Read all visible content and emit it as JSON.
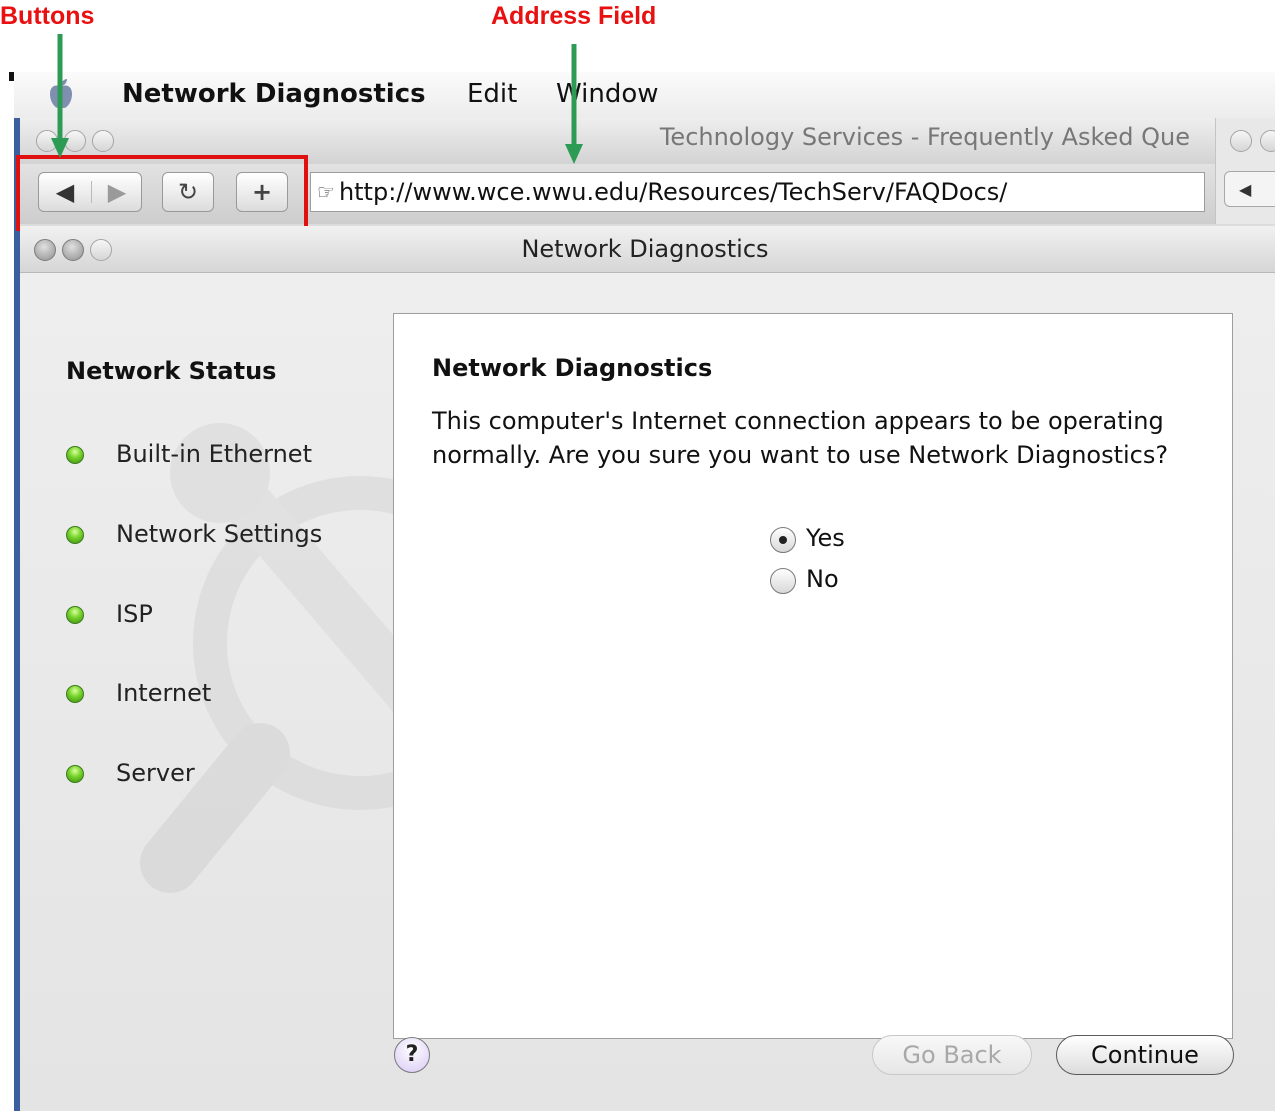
{
  "annotations": {
    "buttons_label": "Buttons",
    "address_label": "Address Field"
  },
  "menubar": {
    "app_name": "Network Diagnostics",
    "items": [
      "Edit",
      "Window"
    ]
  },
  "browser": {
    "title": "Technology Services - Frequently Asked Que",
    "toolbar": {
      "back_glyph": "◀",
      "forward_glyph": "▶",
      "reload_glyph": "↻",
      "add_glyph": "+"
    },
    "address": {
      "icon": "☞",
      "url": "http://www.wce.wwu.edu/Resources/TechServ/FAQDocs/"
    },
    "side_back_glyph": "◀"
  },
  "dialog": {
    "title": "Network Diagnostics",
    "status_heading": "Network Status",
    "status_items": [
      "Built-in Ethernet",
      "Network Settings",
      "ISP",
      "Internet",
      "Server"
    ],
    "status_color": "#5cbf1f",
    "content_heading": "Network Diagnostics",
    "message": "This computer's Internet connection appears to be operating normally. Are you sure you want to use Network Diagnostics?",
    "options": [
      {
        "label": "Yes",
        "selected": true
      },
      {
        "label": "No",
        "selected": false
      }
    ],
    "help": "?",
    "go_back": "Go Back",
    "continue": "Continue"
  },
  "colors": {
    "annotation_red": "#e81010",
    "arrow_green": "#2e9b55"
  }
}
